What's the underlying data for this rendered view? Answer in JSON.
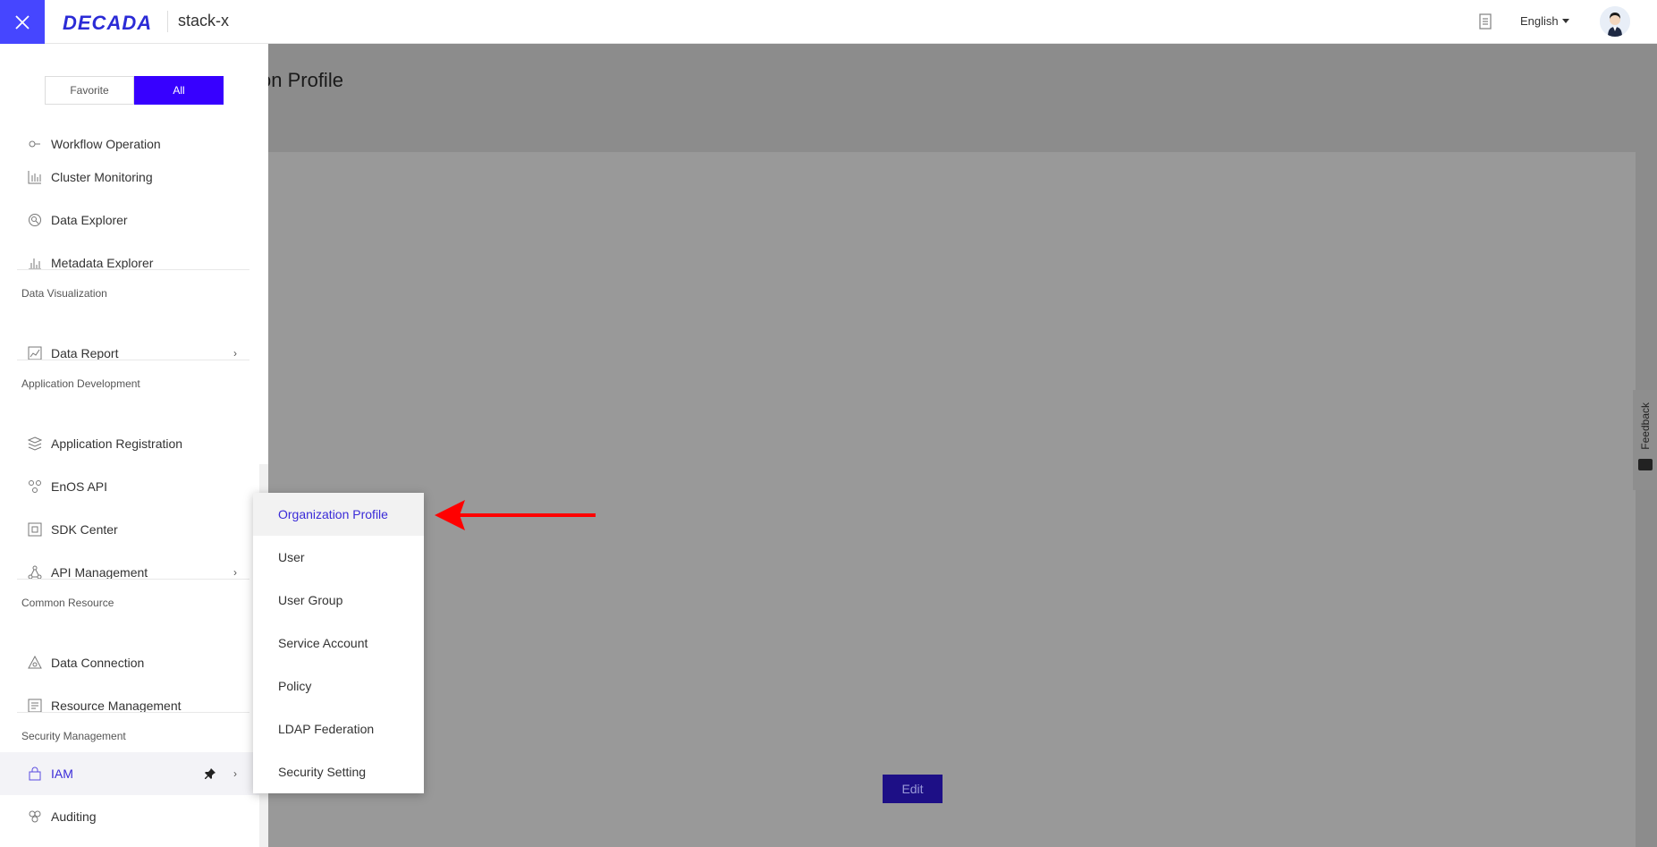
{
  "topbar": {
    "logo_text": "DECADA",
    "stack_name": "stack-x",
    "language": "English",
    "icons": {
      "close": "close-icon",
      "document": "document-icon",
      "avatar": "user-avatar"
    }
  },
  "main": {
    "page_title": "tion Profile",
    "edit_label": "Edit",
    "feedback_label": "Feedback"
  },
  "sidebar": {
    "toggle": {
      "favorite": "Favorite",
      "all": "All",
      "active": "All"
    },
    "items": [
      {
        "label": "Workflow Operation",
        "icon": "workflow-icon"
      },
      {
        "label": "Cluster Monitoring",
        "icon": "bar-chart-icon"
      },
      {
        "label": "Data Explorer",
        "icon": "explorer-icon"
      },
      {
        "label": "Metadata Explorer",
        "icon": "metadata-chart-icon"
      },
      {
        "label": "Data Report",
        "icon": "line-chart-icon",
        "has_submenu": true
      },
      {
        "label": "Application Registration",
        "icon": "stack-layers-icon"
      },
      {
        "label": "EnOS API",
        "icon": "api-cluster-icon"
      },
      {
        "label": "SDK Center",
        "icon": "sdk-box-icon"
      },
      {
        "label": "API Management",
        "icon": "api-network-icon",
        "has_submenu": true
      },
      {
        "label": "Data Connection",
        "icon": "connection-triangle-icon"
      },
      {
        "label": "Resource Management",
        "icon": "resource-icon"
      },
      {
        "label": "IAM",
        "icon": "iam-lock-icon",
        "has_submenu": true,
        "pinned": true,
        "active": true
      },
      {
        "label": "Auditing",
        "icon": "auditing-icon"
      }
    ],
    "sections": {
      "data_visualization": "Data Visualization",
      "application_development": "Application Development",
      "common_resource": "Common Resource",
      "security_management": "Security Management"
    }
  },
  "flyout": {
    "items": [
      "Organization Profile",
      "User",
      "User Group",
      "Service Account",
      "Policy",
      "LDAP Federation",
      "Security Setting"
    ],
    "active": "Organization Profile"
  },
  "colors": {
    "accent": "#3700ff",
    "close_bg": "#4646ff",
    "overlay": "#8c8c8c",
    "active_text": "#3a2bd8",
    "arrow": "#ff0000"
  }
}
